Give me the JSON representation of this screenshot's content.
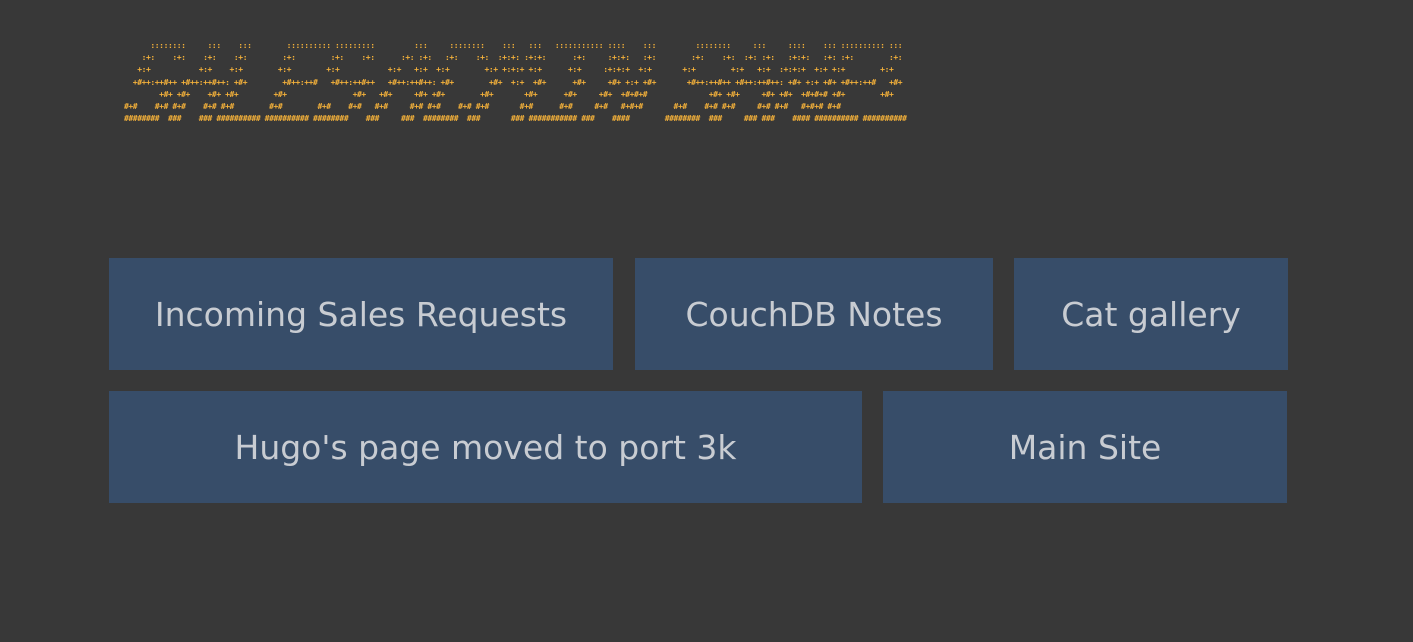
{
  "banner": {
    "art": "      ::::::::     :::    :::        :::::::::: :::::::::         :::     ::::::::    :::   :::   ::::::::::: ::::    :::         ::::::::     :::     ::::    ::: :::::::::: :::\n    :+:    :+:    :+:    :+:        :+:        :+:    :+:      :+: :+:   :+:    :+:  :+:+: :+:+:      :+:     :+:+:   :+:        :+:    :+:  :+: :+:   :+:+:   :+: :+:        :+:\n   +:+           +:+    +:+        +:+        +:+           +:+   +:+  +:+        +:+ +:+:+ +:+      +:+     :+:+:+  +:+       +:+        +:+   +:+  :+:+:+  +:+ +:+        +:+\n  +#++:++#++ +#++:++#++: +#+        +#++:++#   +#++:++#++   +#++:++#++: +#+        +#+  +:+  +#+      +#+     +#+ +:+ +#+       +#++:++#++ +#++:++#++: +#+ +:+ +#+ +#++:++#   +#+\n        +#+ +#+    +#+ +#+        +#+               +#+   +#+     +#+ +#+        +#+       +#+      +#+     +#+  +#+#+#              +#+ +#+     +#+ +#+  +#+#+# +#+        +#+\n#+#    #+# #+#    #+# #+#        #+#        #+#    #+#   #+#     #+# #+#    #+# #+#       #+#      #+#     #+#   #+#+#       #+#    #+# #+#     #+# #+#   #+#+# #+#\n########  ###    ### ########## ########## ########    ###     ###  ########  ###       ### ########### ###    ####        ########  ###     ### ###    #### ########## ##########"
  },
  "links": [
    {
      "label": "Incoming Sales Requests"
    },
    {
      "label": "CouchDB Notes"
    },
    {
      "label": "Cat gallery"
    },
    {
      "label": "Hugo's page moved to port 3k"
    },
    {
      "label": "Main Site"
    }
  ],
  "colors": {
    "background": "#383838",
    "tile": "#374d69",
    "tile_text": "#c8ccd2",
    "banner_text": "#f4b13a"
  }
}
